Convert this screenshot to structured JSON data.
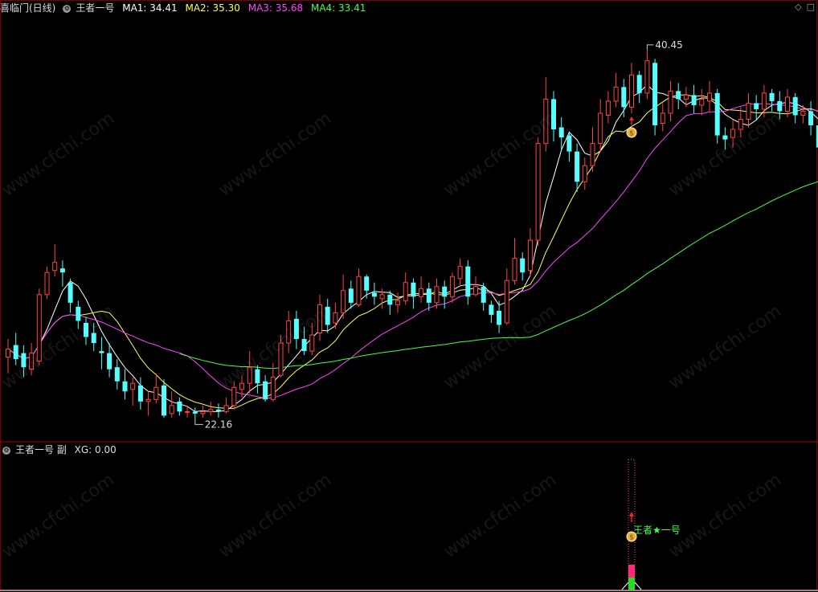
{
  "main_header": {
    "stock_period": "喜临门(日线)",
    "indicator_name": "王者一号",
    "ma": [
      {
        "label": "MA1: ",
        "value": "34.41",
        "color": "#ffffff"
      },
      {
        "label": "MA2: ",
        "value": "35.30",
        "color": "#ffff55"
      },
      {
        "label": "MA3: ",
        "value": "35.68",
        "color": "#ff44ff"
      },
      {
        "label": "MA4: ",
        "value": "33.41",
        "color": "#44ff44"
      }
    ]
  },
  "sub_header": {
    "indicator_name": "王者一号 副",
    "xg_label": "XG: ",
    "xg_value": "0.00"
  },
  "annotations": {
    "high_label": "40.45",
    "low_label": "22.16",
    "signal_text": "王者★一号",
    "signal_index": 80
  },
  "watermark": "www.cfchi.com",
  "colors": {
    "up": "#ff4444",
    "down": "#55ffff",
    "ma1": "#ffffff",
    "ma2": "#ffff55",
    "ma3": "#ff44ff",
    "ma4": "#44ff44",
    "divider": "#b00000",
    "signal": "#44ff44"
  },
  "chart_data": {
    "type": "candlestick",
    "ylim": [
      21.2,
      42.2
    ],
    "candles": [
      [
        25.2,
        25.6,
        26.1,
        24.4
      ],
      [
        25.8,
        25.1,
        26.4,
        24.8
      ],
      [
        25.4,
        24.7,
        25.8,
        24.2
      ],
      [
        24.6,
        25.4,
        25.9,
        24.3
      ],
      [
        25.0,
        28.3,
        28.6,
        24.8
      ],
      [
        28.3,
        29.4,
        29.7,
        28.1
      ],
      [
        29.5,
        29.9,
        30.8,
        29.2
      ],
      [
        29.6,
        29.4,
        30.0,
        28.7
      ],
      [
        28.9,
        27.9,
        29.1,
        27.4
      ],
      [
        27.7,
        27.0,
        28.0,
        26.6
      ],
      [
        26.9,
        26.2,
        27.2,
        25.8
      ],
      [
        26.4,
        25.9,
        26.9,
        25.5
      ],
      [
        25.5,
        25.4,
        26.2,
        24.6
      ],
      [
        25.4,
        24.6,
        25.9,
        24.2
      ],
      [
        24.7,
        24.0,
        25.1,
        23.6
      ],
      [
        24.0,
        23.5,
        24.6,
        23.1
      ],
      [
        23.6,
        23.9,
        24.2,
        22.8
      ],
      [
        23.8,
        23.0,
        24.2,
        22.6
      ],
      [
        23.0,
        23.1,
        23.5,
        22.3
      ],
      [
        23.1,
        23.7,
        24.4,
        22.9
      ],
      [
        23.8,
        22.3,
        24.1,
        22.2
      ],
      [
        22.4,
        22.8,
        23.5,
        22.2
      ],
      [
        23.0,
        22.5,
        23.2,
        22.3
      ],
      [
        22.5,
        22.5,
        22.8,
        22.2
      ],
      [
        22.5,
        22.4,
        22.7,
        22.1
      ],
      [
        22.4,
        22.5,
        22.8,
        22.2
      ],
      [
        22.5,
        22.6,
        23.0,
        22.3
      ],
      [
        22.6,
        22.5,
        22.9,
        22.2
      ],
      [
        22.5,
        22.8,
        23.2,
        22.4
      ],
      [
        22.8,
        23.7,
        24.0,
        22.6
      ],
      [
        23.6,
        23.9,
        24.3,
        23.2
      ],
      [
        23.9,
        24.7,
        25.5,
        23.4
      ],
      [
        24.6,
        23.9,
        24.8,
        23.4
      ],
      [
        24.0,
        23.1,
        24.3,
        23.0
      ],
      [
        23.1,
        24.2,
        24.9,
        23.0
      ],
      [
        24.3,
        25.9,
        26.3,
        24.2
      ],
      [
        25.9,
        27.0,
        27.5,
        25.4
      ],
      [
        27.1,
        26.1,
        27.5,
        25.6
      ],
      [
        26.1,
        25.5,
        26.7,
        25.3
      ],
      [
        25.5,
        26.3,
        26.9,
        25.3
      ],
      [
        26.4,
        27.8,
        28.3,
        26.0
      ],
      [
        27.7,
        26.8,
        28.1,
        26.4
      ],
      [
        26.9,
        27.4,
        27.9,
        26.6
      ],
      [
        27.4,
        28.5,
        29.3,
        27.1
      ],
      [
        28.6,
        27.9,
        29.0,
        27.6
      ],
      [
        27.8,
        29.2,
        29.6,
        27.7
      ],
      [
        29.2,
        28.5,
        29.3,
        28.1
      ],
      [
        28.4,
        28.2,
        28.9,
        27.8
      ],
      [
        28.1,
        28.3,
        28.6,
        27.6
      ],
      [
        28.3,
        27.8,
        28.5,
        27.3
      ],
      [
        27.8,
        28.0,
        28.4,
        27.4
      ],
      [
        28.0,
        28.9,
        29.4,
        27.8
      ],
      [
        28.9,
        28.2,
        29.1,
        27.6
      ],
      [
        28.2,
        28.6,
        29.2,
        27.9
      ],
      [
        28.6,
        27.9,
        28.9,
        27.5
      ],
      [
        27.9,
        28.7,
        29.1,
        27.6
      ],
      [
        28.7,
        28.2,
        29.0,
        27.6
      ],
      [
        28.2,
        29.2,
        29.4,
        27.9
      ],
      [
        29.1,
        29.7,
        30.1,
        28.7
      ],
      [
        29.7,
        28.2,
        30.0,
        27.8
      ],
      [
        28.3,
        28.7,
        29.2,
        28.2
      ],
      [
        28.7,
        27.9,
        28.9,
        27.5
      ],
      [
        27.8,
        27.3,
        28.0,
        26.9
      ],
      [
        27.5,
        26.8,
        28.0,
        26.4
      ],
      [
        26.9,
        29.0,
        29.6,
        26.8
      ],
      [
        29.0,
        30.1,
        31.1,
        28.8
      ],
      [
        30.1,
        29.4,
        30.4,
        29.0
      ],
      [
        29.5,
        31.0,
        31.6,
        29.2
      ],
      [
        31.0,
        35.8,
        36.1,
        30.7
      ],
      [
        35.8,
        38.0,
        39.1,
        35.4
      ],
      [
        38.0,
        36.5,
        38.4,
        35.9
      ],
      [
        36.6,
        36.1,
        37.1,
        35.5
      ],
      [
        36.2,
        35.4,
        36.4,
        34.9
      ],
      [
        35.4,
        33.9,
        35.8,
        33.4
      ],
      [
        33.9,
        34.7,
        35.1,
        33.5
      ],
      [
        34.7,
        35.8,
        36.6,
        34.4
      ],
      [
        35.8,
        37.3,
        38.0,
        35.4
      ],
      [
        37.2,
        37.9,
        38.4,
        36.8
      ],
      [
        37.9,
        38.6,
        39.3,
        37.6
      ],
      [
        38.6,
        37.6,
        39.0,
        37.1
      ],
      [
        37.6,
        39.2,
        39.8,
        37.3
      ],
      [
        39.2,
        38.3,
        39.4,
        37.8
      ],
      [
        38.3,
        39.9,
        40.45,
        38.0
      ],
      [
        39.8,
        36.7,
        40.0,
        36.2
      ],
      [
        36.8,
        37.3,
        37.8,
        36.4
      ],
      [
        37.3,
        38.4,
        38.9,
        36.9
      ],
      [
        38.4,
        38.0,
        38.8,
        37.5
      ],
      [
        38.0,
        38.2,
        38.6,
        37.6
      ],
      [
        38.2,
        37.7,
        38.7,
        37.3
      ],
      [
        37.7,
        38.0,
        38.5,
        37.2
      ],
      [
        37.9,
        38.3,
        38.9,
        37.4
      ],
      [
        38.3,
        36.2,
        38.5,
        35.8
      ],
      [
        36.2,
        36.0,
        36.6,
        35.5
      ],
      [
        36.1,
        36.5,
        37.0,
        35.6
      ],
      [
        36.5,
        37.0,
        37.6,
        36.1
      ],
      [
        37.0,
        37.8,
        38.3,
        36.6
      ],
      [
        37.8,
        37.5,
        38.2,
        37.0
      ],
      [
        37.5,
        38.3,
        38.7,
        37.1
      ],
      [
        38.3,
        37.9,
        38.5,
        37.4
      ],
      [
        37.9,
        37.4,
        38.4,
        37.0
      ],
      [
        37.4,
        38.1,
        38.5,
        37.1
      ],
      [
        38.1,
        37.2,
        38.3,
        36.8
      ],
      [
        37.2,
        37.4,
        37.7,
        36.8
      ],
      [
        37.4,
        36.7,
        37.9,
        36.2
      ],
      [
        36.7,
        35.6,
        36.9,
        35.2
      ],
      [
        35.6,
        35.2,
        35.9,
        34.8
      ]
    ]
  }
}
